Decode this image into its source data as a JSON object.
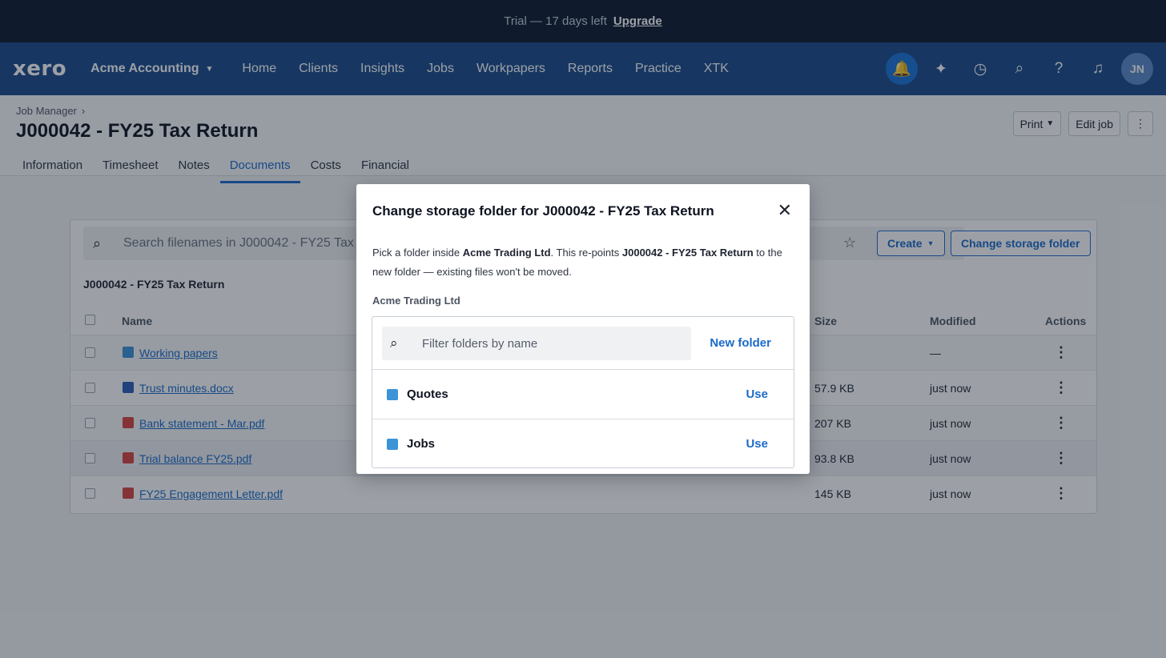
{
  "trial_banner": {
    "text": "Trial — 17 days left",
    "upgrade_label": "Upgrade"
  },
  "topnav": {
    "logo": "xero",
    "org_name": "Acme Accounting",
    "items": [
      "Home",
      "Clients",
      "Insights",
      "Jobs",
      "Workpapers",
      "Reports",
      "Practice",
      "XTK"
    ],
    "avatar_initials": "JN"
  },
  "page": {
    "breadcrumb": "Job Manager",
    "breadcrumb_sep": "›",
    "title": "J000042 - FY25 Tax Return",
    "tabs": [
      "Information",
      "Timesheet",
      "Notes",
      "Documents",
      "Costs",
      "Financial"
    ],
    "active_tab": "Documents",
    "print_label": "Print",
    "edit_job_label": "Edit job",
    "more_label": "⋮"
  },
  "documents": {
    "search_placeholder": "Search filenames in J000042 - FY25 Tax Return",
    "create_label": "Create",
    "change_storage_label": "Change storage folder",
    "folder_title": "J000042 - FY25 Tax Return",
    "columns": {
      "name": "Name",
      "size": "Size",
      "modified": "Modified",
      "actions": "Actions"
    },
    "rows": [
      {
        "name": "Working papers",
        "type": "folder",
        "size": "",
        "modified": "—"
      },
      {
        "name": "Trust minutes.docx",
        "type": "word",
        "size": "57.9 KB",
        "modified": "just now"
      },
      {
        "name": "Bank statement - Mar.pdf",
        "type": "pdf",
        "size": "207 KB",
        "modified": "just now"
      },
      {
        "name": "Trial balance FY25.pdf",
        "type": "pdf",
        "size": "93.8 KB",
        "modified": "just now"
      },
      {
        "name": "FY25 Engagement Letter.pdf",
        "type": "pdf",
        "size": "145 KB",
        "modified": "just now"
      }
    ]
  },
  "modal": {
    "title": "Change storage folder for J000042 - FY25 Tax Return",
    "desc_1": "Pick a folder inside ",
    "desc_org": "Acme Trading Ltd",
    "desc_2": ". This re-points ",
    "desc_job": "J000042 - FY25 Tax Return",
    "desc_3": " to the new folder — existing files won't be moved.",
    "org_label": "Acme Trading Ltd",
    "filter_placeholder": "Filter folders by name",
    "new_folder_label": "New folder",
    "folders": [
      {
        "name": "Quotes",
        "action": "Use"
      },
      {
        "name": "Jobs",
        "action": "Use"
      }
    ]
  },
  "colors": {
    "banner_bg": "#0d1b2e",
    "nav_bg": "#1b4a8a",
    "accent": "#1b6ac9",
    "folder": "#3c93d8",
    "pdf": "#d64540",
    "word": "#2b5eb8"
  }
}
